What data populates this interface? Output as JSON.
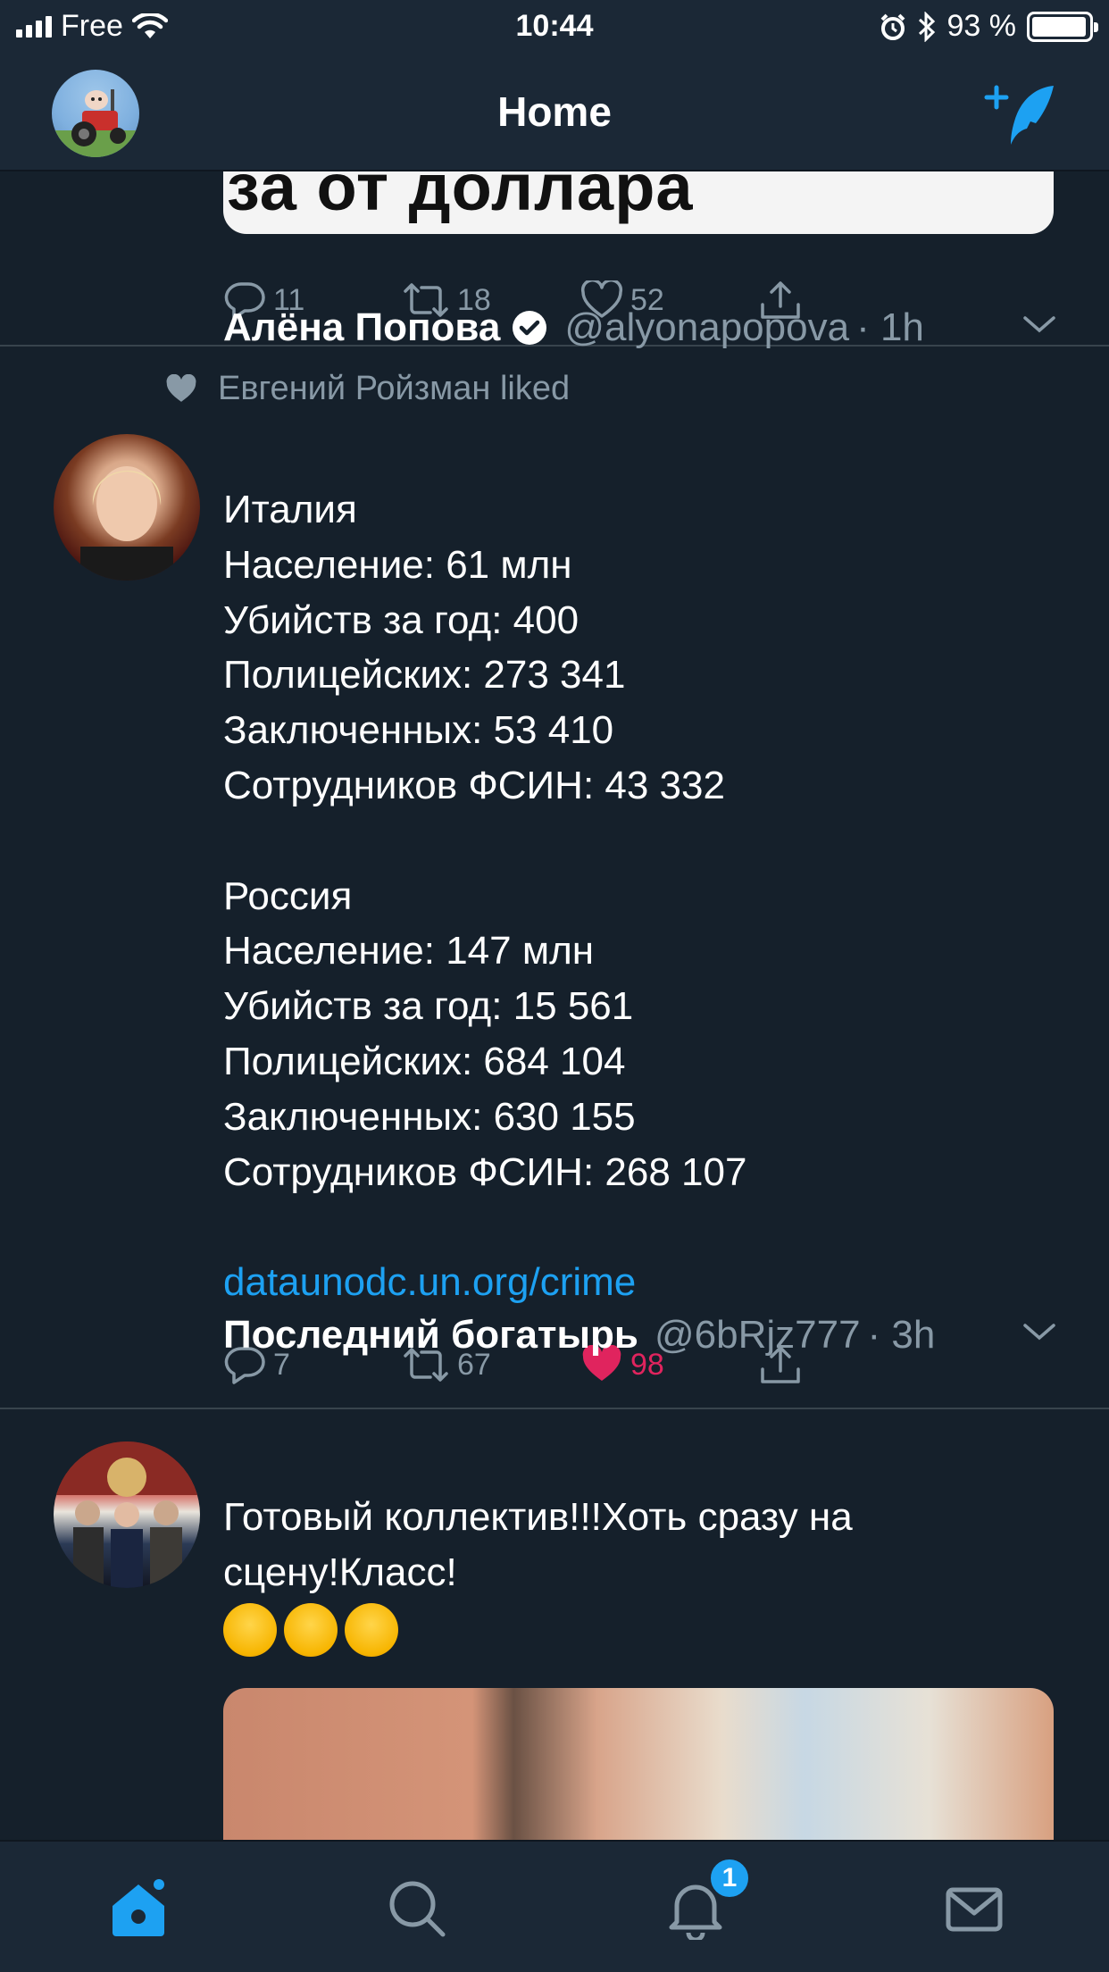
{
  "status_bar": {
    "carrier": "Free",
    "time": "10:44",
    "battery_percent": "93 %",
    "icons": [
      "signal-icon",
      "wifi-icon",
      "alarm-icon",
      "bluetooth-icon",
      "battery-icon"
    ]
  },
  "header": {
    "title": "Home",
    "accent_color": "#1da1f2"
  },
  "feed": {
    "prev_tweet": {
      "image_caption": "за от доллара",
      "replies": "11",
      "retweets": "18",
      "likes": "52"
    },
    "tweet1": {
      "social_context": "Евгений Ройзман liked",
      "name": "Алёна Попова",
      "handle": "@alyonapopova",
      "time": "· 1h",
      "verified": true,
      "lines_block1": [
        "Италия",
        "Население: 61 млн",
        "Убийств за год: 400",
        "Полицейских: 273 341",
        "Заключенных: 53 410",
        "Сотрудников ФСИН: 43 332"
      ],
      "lines_block2": [
        "Россия",
        "Население: 147 млн",
        "Убийств за год: 15 561",
        "Полицейских: 684 104",
        "Заключенных: 630 155",
        "Сотрудников ФСИН: 268 107"
      ],
      "link": "dataunodc.un.org/crime",
      "replies": "7",
      "retweets": "67",
      "likes": "98",
      "liked": true,
      "like_color": "#e0245e"
    },
    "tweet2": {
      "name": "Последний богатырь",
      "handle": "@6bRjz777",
      "time": "· 3h",
      "text_line1": "Готовый коллектив!!!Хоть сразу на",
      "text_line2": "сцену!Класс!",
      "emojis": [
        "hugging-face-emoji",
        "hugging-face-emoji",
        "hugging-face-emoji"
      ]
    }
  },
  "tab_bar": {
    "tabs": [
      "home",
      "search",
      "notifications",
      "messages"
    ],
    "notifications_badge": "1"
  }
}
